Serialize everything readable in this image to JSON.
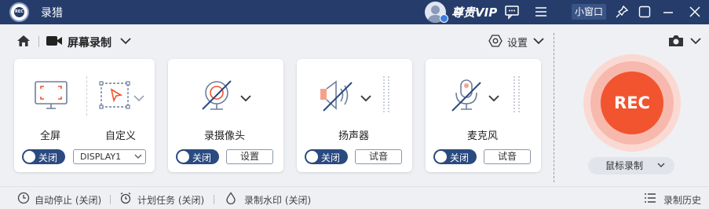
{
  "app": {
    "title": "录猎",
    "logo_text": "REC"
  },
  "titlebar": {
    "vip_label": "尊贵VIP",
    "mini_window_label": "小窗口"
  },
  "toolbar": {
    "mode_label": "屏幕录制",
    "settings_label": "设置"
  },
  "cards": {
    "screen": {
      "fullscreen_label": "全屏",
      "custom_label": "自定义",
      "toggle_label": "关闭",
      "display_value": "DISPLAY1"
    },
    "camera": {
      "label": "录摄像头",
      "toggle_label": "关闭",
      "button_label": "设置"
    },
    "speaker": {
      "label": "扬声器",
      "toggle_label": "关闭",
      "button_label": "试音"
    },
    "microphone": {
      "label": "麦克风",
      "toggle_label": "关闭",
      "button_label": "试音"
    }
  },
  "record": {
    "button_label": "REC",
    "mouse_mode_label": "鼠标录制"
  },
  "bottom": {
    "auto_stop": "自动停止 (关闭)",
    "scheduled_task": "计划任务 (关闭)",
    "watermark": "录制水印 (关闭)",
    "history": "录制历史"
  },
  "colors": {
    "titlebar": "#263d6b",
    "accent": "#2a4a80",
    "rec": "#f1542e"
  }
}
